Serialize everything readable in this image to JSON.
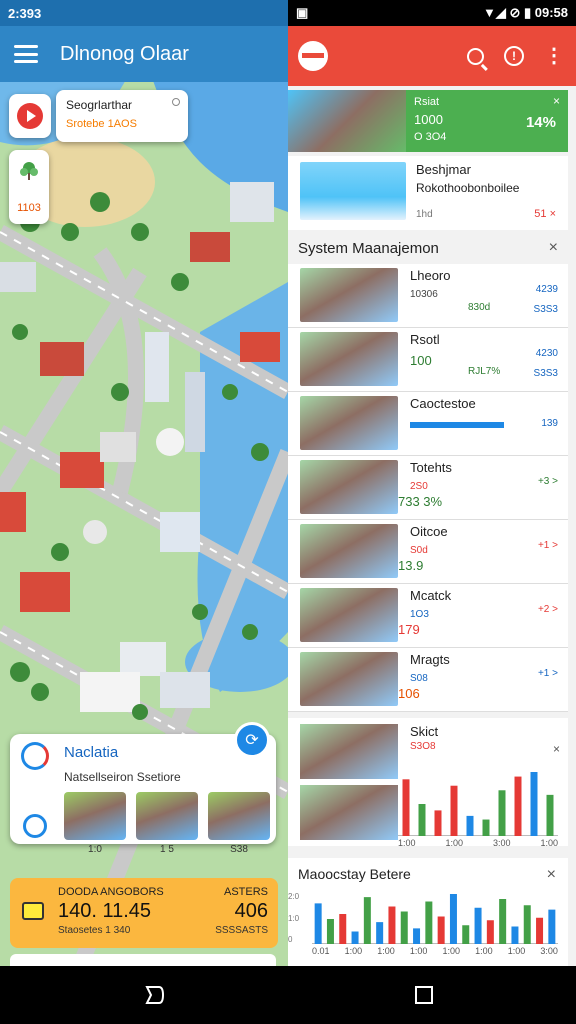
{
  "left_app": {
    "status_time": "2:393",
    "title": "Dlnonog Olaar",
    "info_card": {
      "title": "Seogrlarthar",
      "subtitle": "Srotebe 1AOS"
    },
    "tree_card_value": "1103",
    "bottom_card": {
      "name": "Naclatia",
      "subtitle": "Natsellseiron Ssetiore",
      "thumbs": [
        {
          "caption": "1:0"
        },
        {
          "caption": "1 5"
        },
        {
          "caption": "S38"
        }
      ]
    },
    "promo": {
      "line1_left": "DOODA ANGOBORS",
      "line1_right": "ASTERS",
      "line2_left": "140. 11.45",
      "line2_right": "406",
      "line3_left": "Staosetes 1 340",
      "line3_right": "SSSSASTS"
    }
  },
  "right_app": {
    "status_time": "09:58",
    "hero": {
      "a": "Rsiat",
      "b": "1000",
      "c": "O 3O4",
      "percent": "14%",
      "close": "×"
    },
    "feature": {
      "title": "Beshjmar",
      "subtitle": "Rokothoobonboilee",
      "tag": "1hd",
      "value": "51 ×"
    },
    "section_title": "System Maanajemon",
    "section_close": "×",
    "rows": [
      {
        "name": "Lheoro",
        "v1": "10306",
        "v2": "830d",
        "d1": "4239",
        "d2": "S3S3"
      },
      {
        "name": "Rsotl",
        "v1": "100",
        "v2": "RJL7%",
        "d1": "4230",
        "d2": "S3S3",
        "v1_color": "#2e7d32"
      },
      {
        "name": "Caoctestoe",
        "d1": "139",
        "bar": true
      },
      {
        "name": "Totehts",
        "v1": "2S0",
        "v2": "733 3%",
        "d1": "+3 >",
        "v2_color": "#2e7d32"
      },
      {
        "name": "Oitcoe",
        "v1": "S0d",
        "v2": "13.9",
        "d1": "+1 >",
        "v2_color": "#2e7d32"
      },
      {
        "name": "Mcatck",
        "v1": "1O3",
        "v2": "179",
        "d1": "+2 >",
        "v2_color": "#e53935"
      },
      {
        "name": "Mragts",
        "v1": "S08",
        "v2": "106",
        "d1": "+1 >",
        "v2_color": "#e65100"
      }
    ],
    "chart_card": {
      "name": "Skict",
      "sub": "S3O8",
      "close": "×",
      "labels": [
        "1:00",
        "1:00",
        "3:00",
        "1:00"
      ]
    },
    "bottom_chart": {
      "title": "Maoocstay Betere",
      "close": "×",
      "axis": [
        "2:0",
        "1:0",
        "0"
      ],
      "labels": [
        "0.01",
        "1:00",
        "1:00",
        "1:00",
        "1:00",
        "1:00",
        "1:00",
        "3:00"
      ]
    }
  },
  "chart_data": [
    {
      "type": "bar",
      "series": [
        {
          "values": [
            62,
            35,
            28,
            55,
            22,
            18,
            50,
            65,
            70,
            45
          ]
        }
      ],
      "colors": [
        "#e53935",
        "#43a047",
        "#e53935",
        "#e53935",
        "#1e88e5",
        "#43a047",
        "#43a047",
        "#e53935",
        "#1e88e5",
        "#43a047"
      ],
      "ylim": [
        0,
        70
      ]
    },
    {
      "type": "bar",
      "series": [
        {
          "values": [
            65,
            40,
            48,
            20,
            75,
            35,
            60,
            52,
            25,
            68,
            44,
            80,
            30,
            58,
            38,
            72,
            28,
            62,
            42,
            55
          ]
        }
      ],
      "colors": [
        "#1e88e5",
        "#43a047",
        "#e53935",
        "#1e88e5",
        "#43a047",
        "#1e88e5",
        "#e53935",
        "#43a047",
        "#1e88e5",
        "#43a047",
        "#e53935",
        "#1e88e5",
        "#43a047",
        "#1e88e5",
        "#e53935",
        "#43a047",
        "#1e88e5",
        "#43a047",
        "#e53935",
        "#1e88e5"
      ],
      "ylim": [
        0,
        80
      ]
    }
  ]
}
